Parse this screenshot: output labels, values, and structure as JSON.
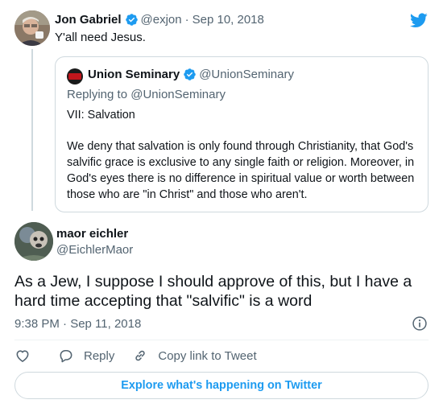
{
  "colors": {
    "accent": "#1d9bf0",
    "text_primary": "#0f1419",
    "text_secondary": "#536471",
    "border": "#cfd9de"
  },
  "parent_tweet": {
    "name": "Jon Gabriel",
    "handle": "@exjon",
    "date": "Sep 10, 2018",
    "separator": "·",
    "text": "Y'all need Jesus.",
    "verified_icon": "verified-badge-icon",
    "brand_icon": "twitter-bird-icon"
  },
  "quoted_tweet": {
    "name": "Union Seminary",
    "handle": "@UnionSeminary",
    "replying_to": "Replying to @UnionSeminary",
    "body_title": "VII: Salvation",
    "body_text": "We deny that salvation is only found through Christianity, that God's salvific grace is exclusive to any single faith or religion. Moreover, in God's eyes there is no difference in spiritual value or worth between those who are \"in Christ\" and those who aren't."
  },
  "reply_tweet": {
    "name": "maor eichler",
    "handle": "@EichlerMaor",
    "text": "As a Jew, I suppose I should approve of this, but I have a hard time accepting that \"salvific\" is a word",
    "timestamp": "9:38 PM · Sep 11, 2018"
  },
  "actions": {
    "reply_label": "Reply",
    "copy_link_label": "Copy link to Tweet"
  },
  "explore_label": "Explore what's happening on Twitter"
}
